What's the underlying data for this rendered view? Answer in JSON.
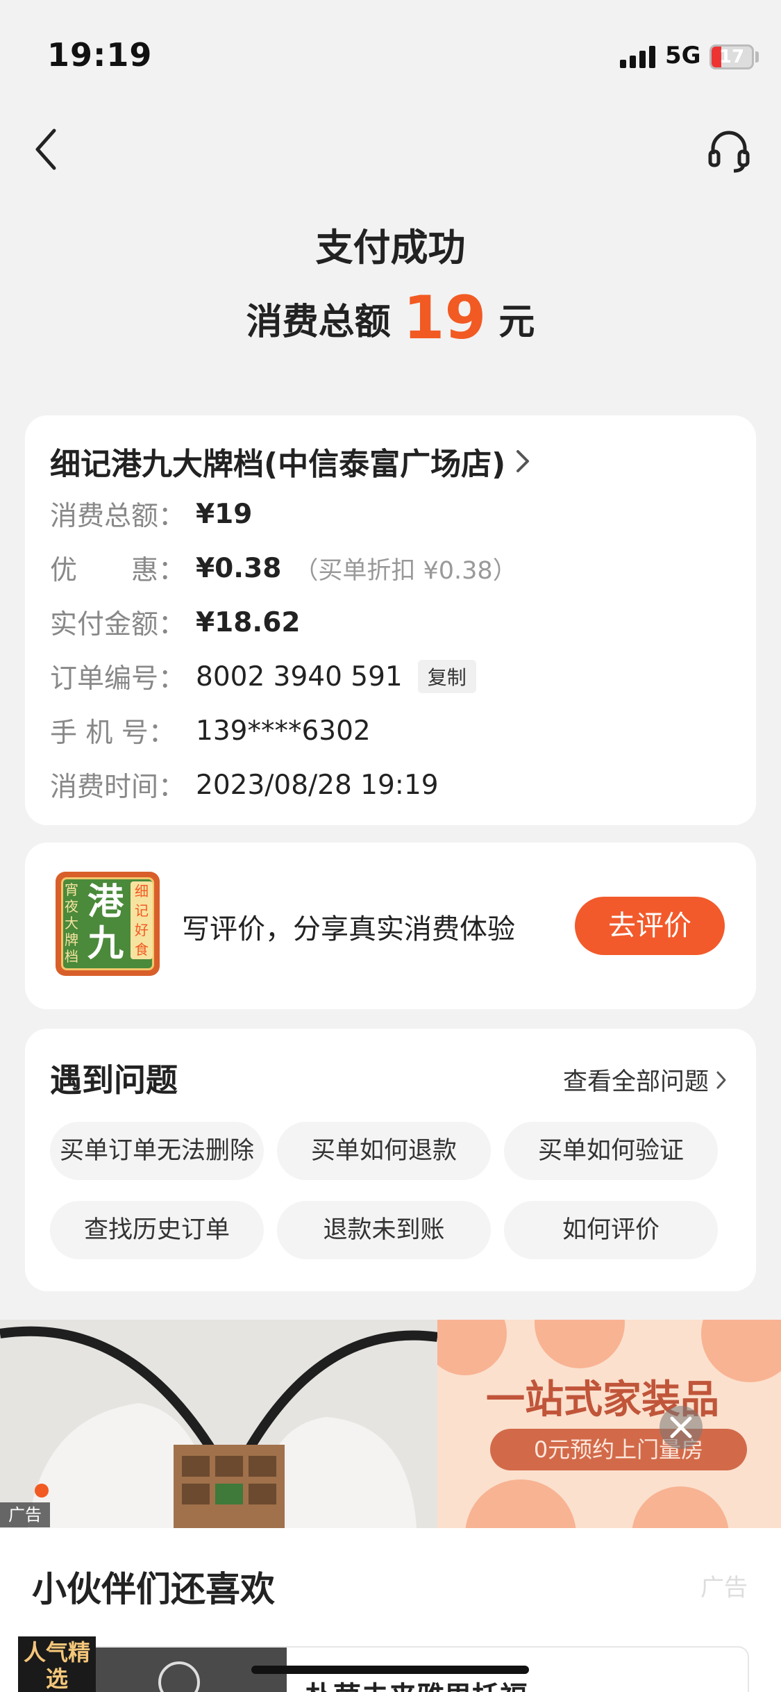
{
  "status_bar": {
    "time": "19:19",
    "network": "5G",
    "battery": "17"
  },
  "header": {
    "title": "支付成功",
    "total_label": "消费总额",
    "total_amount": "19",
    "total_unit": "元"
  },
  "order": {
    "shop_name": "细记港九大牌档(中信泰富广场店)",
    "rows": [
      {
        "label": "消费总额：",
        "value": "¥19",
        "note": ""
      },
      {
        "label": "优　　惠：",
        "value": "¥0.38",
        "note": "（买单折扣 ¥0.38）"
      },
      {
        "label": "实付金额：",
        "value": "¥18.62",
        "note": ""
      },
      {
        "label": "订单编号：",
        "value": "8002 3940 591",
        "note": ""
      },
      {
        "label": "手 机 号：",
        "value": "139****6302",
        "note": ""
      },
      {
        "label": "消费时间：",
        "value": "2023/08/28 19:19",
        "note": ""
      }
    ],
    "copy_label": "复制"
  },
  "review": {
    "logo_text": {
      "main": "港九",
      "side_left": "宵夜大牌档",
      "side_right": "细记好食"
    },
    "prompt": "写评价，分享真实消费体验",
    "button": "去评价"
  },
  "problems": {
    "title": "遇到问题",
    "view_all": "查看全部问题",
    "chips": [
      "买单订单无法删除",
      "买单如何退款",
      "买单如何验证",
      "查找历史订单",
      "退款未到账",
      "如何评价"
    ]
  },
  "ad": {
    "headline": "一站式家装品",
    "subline": "0元预约上门量房",
    "tag": "广告"
  },
  "recommend": {
    "title": "小伙伴们还喜欢",
    "ad_label": "广告",
    "badge": "人气精选",
    "item_name": "朴茵未来雅思托福"
  },
  "colors": {
    "accent": "#f25a23",
    "background": "#f2f2f2"
  }
}
